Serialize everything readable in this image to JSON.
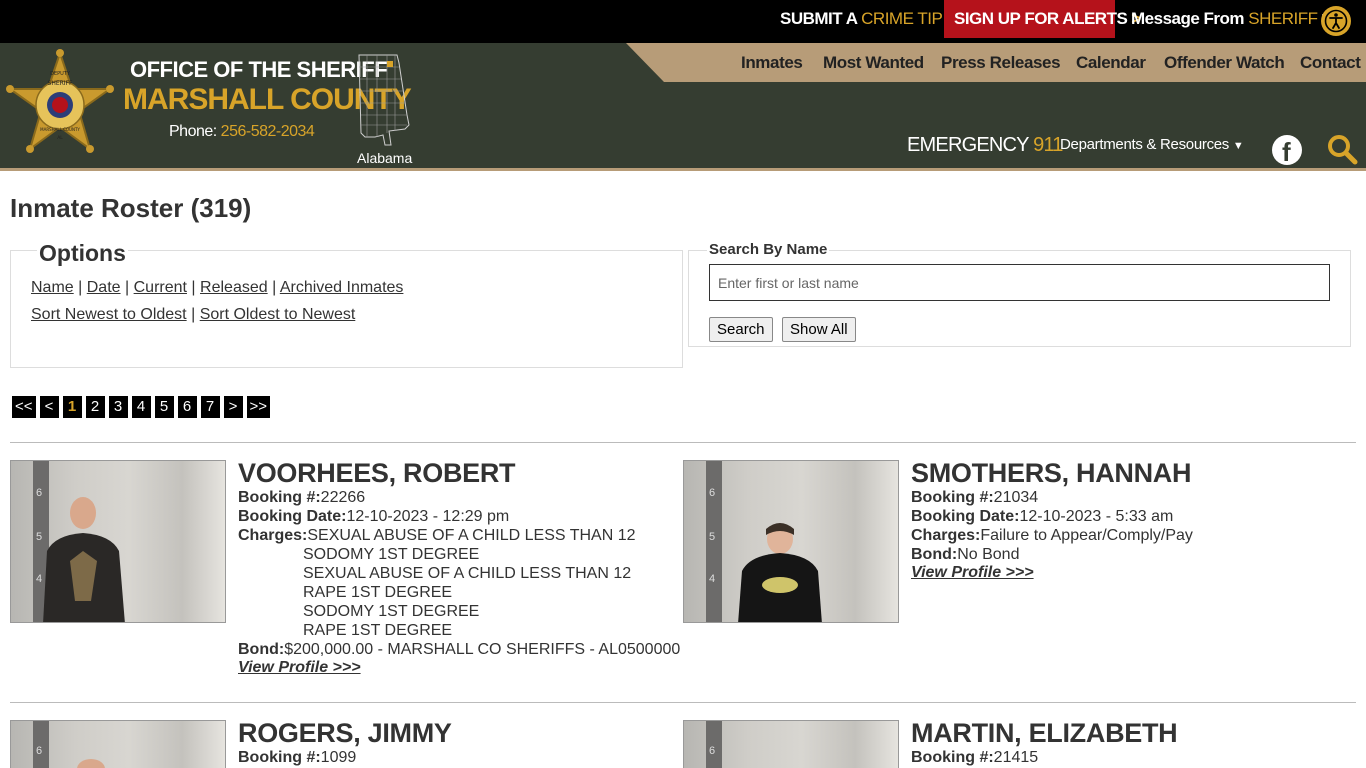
{
  "topbar": {
    "tip_pre": "SUBMIT A",
    "tip_gold": "CRIME TIP",
    "alerts_label": "SIGN UP FOR ALERTS",
    "msg_pre": "Message From",
    "msg_gold": "SHERIFF",
    "chevron": ">"
  },
  "header": {
    "org_line1": "OFFICE OF THE SHERIFF",
    "org_line2": "MARSHALL COUNTY",
    "phone_label": "Phone:",
    "phone_number": "256-582-2034",
    "state": "Alabama",
    "badge_text": [
      "DEPUTY",
      "SHERIFF",
      "MARSHALL COUNTY",
      "AL"
    ],
    "nav": [
      "Inmates",
      "Most Wanted",
      "Press Releases",
      "Calendar",
      "Offender Watch",
      "Contact"
    ],
    "emergency_label": "EMERGENCY",
    "emergency_number": "911",
    "departments_label": "Departments & Resources",
    "facebook_letter": "f"
  },
  "page": {
    "title": "Inmate Roster (319)"
  },
  "options": {
    "legend": "Options",
    "row1": [
      "Name",
      "Date",
      "Current",
      "Released",
      "Archived Inmates"
    ],
    "row2": [
      "Sort Newest to Oldest",
      "Sort Oldest to Newest"
    ],
    "separator": "|"
  },
  "search": {
    "legend": "Search By Name",
    "placeholder": "Enter first or last name",
    "value": "",
    "search_button": "Search",
    "showall_button": "Show All"
  },
  "pagination": [
    "<<",
    "<",
    "1",
    "2",
    "3",
    "4",
    "5",
    "6",
    "7",
    ">",
    ">>"
  ],
  "pagination_current": "1",
  "labels": {
    "booking_no": "Booking #:",
    "booking_date": "Booking Date:",
    "charges": "Charges:",
    "bond": "Bond:",
    "view_profile": "View Profile >>>"
  },
  "ruler_marks": [
    "6",
    "5",
    "4"
  ],
  "inmates": [
    {
      "name": "VOORHEES, ROBERT",
      "booking_no": "22266",
      "booking_date": "12-10-2023 - 12:29 pm",
      "charges": [
        "SEXUAL ABUSE OF A CHILD LESS THAN 12",
        "SODOMY 1ST DEGREE",
        "SEXUAL ABUSE OF A CHILD LESS THAN 12",
        "RAPE 1ST DEGREE",
        "SODOMY 1ST DEGREE",
        "RAPE 1ST DEGREE"
      ],
      "bond": "$200,000.00 - MARSHALL CO SHERIFFS - AL0500000"
    },
    {
      "name": "SMOTHERS, HANNAH",
      "booking_no": "21034",
      "booking_date": "12-10-2023 - 5:33 am",
      "charges": [
        "Failure to Appear/Comply/Pay"
      ],
      "bond": "No Bond"
    },
    {
      "name": "ROGERS, JIMMY",
      "booking_no": "1099"
    },
    {
      "name": "MARTIN, ELIZABETH",
      "booking_no": "21415"
    }
  ],
  "colors": {
    "header_bg": "#353d31",
    "gold": "#d8a429",
    "tan": "#b79c78",
    "alert_red": "#b5121b"
  }
}
